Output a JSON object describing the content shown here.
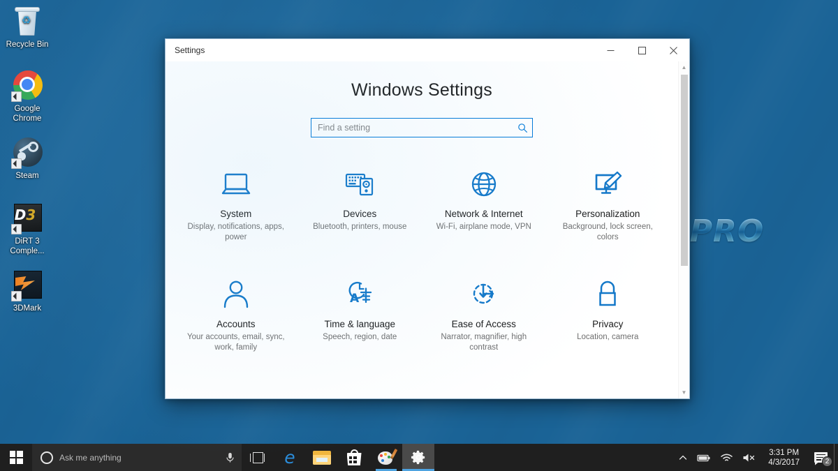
{
  "desktop": {
    "wallpaper_text": "SPRO",
    "icons": [
      {
        "label": "Recycle Bin",
        "icon": "recycle-bin-icon",
        "shortcut": false
      },
      {
        "label": "Google\nChrome",
        "label_line1": "Google",
        "label_line2": "Chrome",
        "icon": "google-chrome-icon",
        "shortcut": true
      },
      {
        "label": "Steam",
        "label_line1": "Steam",
        "label_line2": "",
        "icon": "steam-icon",
        "shortcut": true
      },
      {
        "label": "DiRT 3 Comple...",
        "label_line1": "DiRT 3",
        "label_line2": "Comple...",
        "icon": "dirt3-icon",
        "shortcut": true
      },
      {
        "label": "3DMark",
        "label_line1": "3DMark",
        "label_line2": "",
        "icon": "3dmark-icon",
        "shortcut": true
      }
    ]
  },
  "window": {
    "title": "Settings",
    "controls": {
      "minimize": "–",
      "maximize": "□",
      "close": "✕"
    }
  },
  "settings": {
    "page_title": "Windows Settings",
    "search": {
      "placeholder": "Find a setting",
      "value": "",
      "icon": "search-icon"
    },
    "accent_color": "#0078d7",
    "tiles": [
      {
        "icon": "laptop-icon",
        "title": "System",
        "desc": "Display, notifications, apps, power"
      },
      {
        "icon": "devices-icon",
        "title": "Devices",
        "desc": "Bluetooth, printers, mouse"
      },
      {
        "icon": "globe-icon",
        "title": "Network & Internet",
        "desc": "Wi-Fi, airplane mode, VPN"
      },
      {
        "icon": "monitor-brush-icon",
        "title": "Personalization",
        "desc": "Background, lock screen, colors"
      },
      {
        "icon": "person-icon",
        "title": "Accounts",
        "desc": "Your accounts, email, sync, work, family"
      },
      {
        "icon": "clock-language-icon",
        "title": "Time & language",
        "desc": "Speech, region, date"
      },
      {
        "icon": "ease-of-access-icon",
        "title": "Ease of Access",
        "desc": "Narrator, magnifier, high contrast"
      },
      {
        "icon": "lock-icon",
        "title": "Privacy",
        "desc": "Location, camera"
      }
    ],
    "scrollbar": {
      "up_arrow": "▲",
      "down_arrow": "▼",
      "thumb_percent": 61
    }
  },
  "taskbar": {
    "start": {
      "icon": "windows-logo-icon"
    },
    "cortana": {
      "placeholder": "Ask me anything",
      "ring_icon": "cortana-ring-icon",
      "mic_icon": "microphone-icon"
    },
    "items": [
      {
        "icon": "task-view-icon",
        "label": "Task View",
        "state": "idle"
      },
      {
        "icon": "edge-icon",
        "label": "Microsoft Edge",
        "state": "idle"
      },
      {
        "icon": "file-explorer-icon",
        "label": "File Explorer",
        "state": "idle"
      },
      {
        "icon": "microsoft-store-icon",
        "label": "Microsoft Store",
        "state": "idle"
      },
      {
        "icon": "paint-3d-icon",
        "label": "Paint 3D",
        "state": "running"
      },
      {
        "icon": "settings-gear-icon",
        "label": "Settings",
        "state": "active"
      }
    ],
    "tray": {
      "chevron_icon": "chevron-up-icon",
      "battery_icon": "battery-icon",
      "network_icon": "wifi-icon",
      "volume_icon": "volume-muted-icon",
      "time": "3:31 PM",
      "date": "4/3/2017",
      "action_center_icon": "action-center-icon",
      "notification_count": "2"
    }
  }
}
